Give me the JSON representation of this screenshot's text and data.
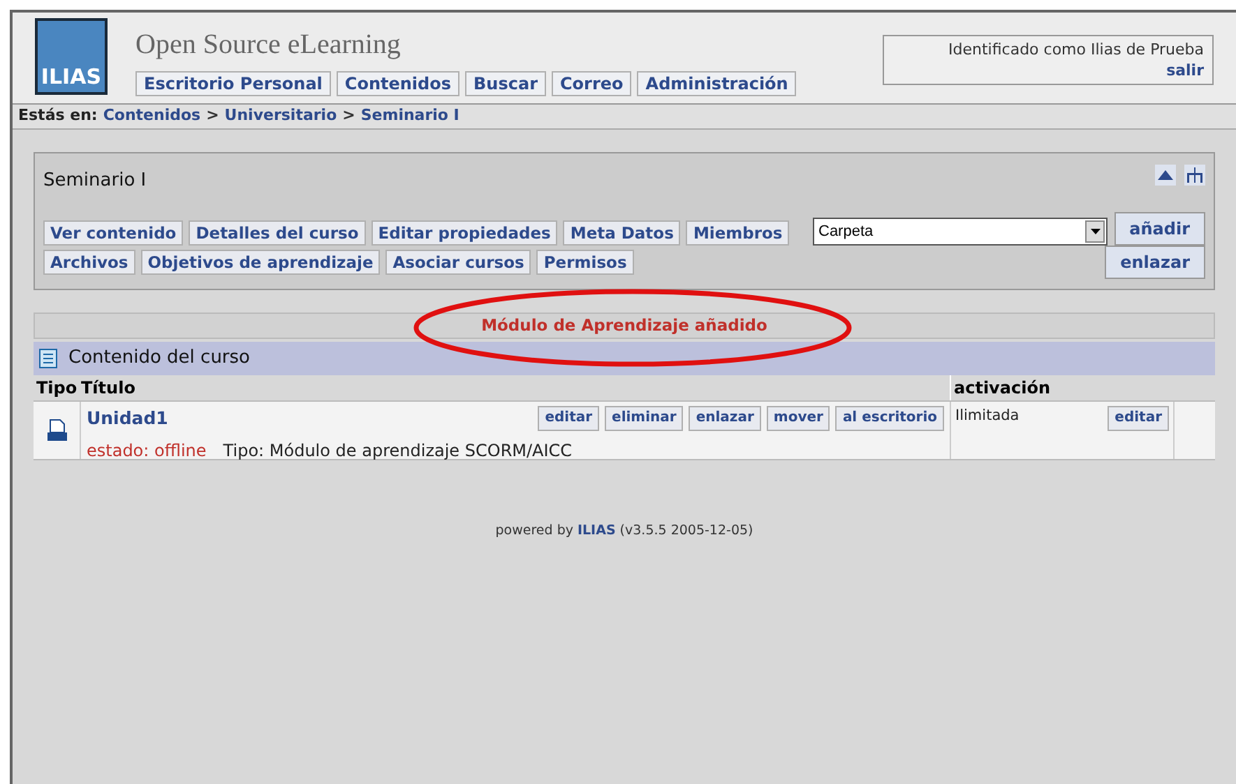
{
  "header": {
    "logo": "ILIAS",
    "site_title": "Open Source eLearning",
    "nav": [
      "Escritorio Personal",
      "Contenidos",
      "Buscar",
      "Correo",
      "Administración"
    ],
    "user": {
      "text": "Identificado como Ilias de Prueba",
      "logout": "salir"
    }
  },
  "breadcrumb": {
    "label": "Estás en:",
    "parts": [
      {
        "kind": "link",
        "text": "Contenidos"
      },
      {
        "kind": "separator",
        "text": ">"
      },
      {
        "kind": "link",
        "text": "Universitario"
      },
      {
        "kind": "separator",
        "text": ">"
      },
      {
        "kind": "link",
        "text": "Seminario I"
      }
    ]
  },
  "course_panel": {
    "title": "Seminario I",
    "tab_rows": [
      [
        "Ver contenido",
        "Detalles del curso",
        "Editar propiedades",
        "Meta Datos",
        "Miembros"
      ],
      [
        "Archivos",
        "Objetivos de aprendizaje",
        "Asociar cursos",
        "Permisos"
      ]
    ],
    "select": {
      "value": "Carpeta"
    },
    "buttons": [
      "añadir",
      "enlazar"
    ]
  },
  "message": {
    "text": "Módulo de Aprendizaje añadido",
    "highlighted": true
  },
  "content": {
    "title": "Contenido del curso",
    "columns": [
      "Tipo",
      "Título",
      "activación"
    ],
    "rows": [
      {
        "title": "Unidad1",
        "status": "estado: offline",
        "type": "Tipo: Módulo de aprendizaje SCORM/AICC",
        "actions": [
          "editar",
          "eliminar",
          "enlazar",
          "mover",
          "al escritorio"
        ],
        "activation": "Ilimitada",
        "activation_action": "editar"
      }
    ]
  },
  "footer": {
    "prefix": "powered by",
    "brand": "ILIAS",
    "version": "(v3.5.5 2005-12-05)"
  }
}
